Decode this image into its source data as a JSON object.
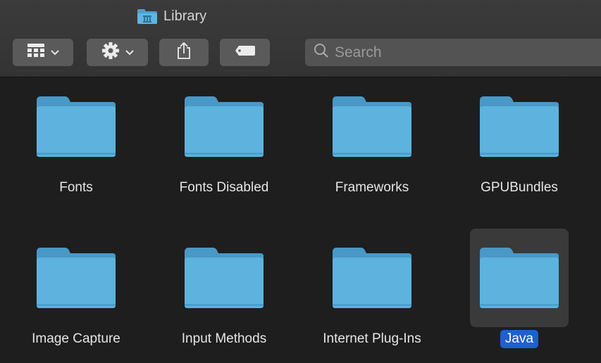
{
  "window": {
    "title": "Library"
  },
  "toolbar": {
    "view_icon": "grid-view-icon",
    "action_icon": "gear-icon",
    "share_icon": "share-icon",
    "tags_icon": "tag-icon",
    "chevron_icon": "chevron-down-icon"
  },
  "search": {
    "placeholder": "Search"
  },
  "folders": [
    {
      "label": "Fonts"
    },
    {
      "label": "Fonts Disabled"
    },
    {
      "label": "Frameworks"
    },
    {
      "label": "GPUBundles"
    },
    {
      "label": "Image Capture"
    },
    {
      "label": "Input Methods"
    },
    {
      "label": "Internet Plug-Ins"
    },
    {
      "label": "Java",
      "selected": true
    }
  ],
  "colors": {
    "folder": "#5db0dc",
    "selection": "#1f5fce"
  }
}
